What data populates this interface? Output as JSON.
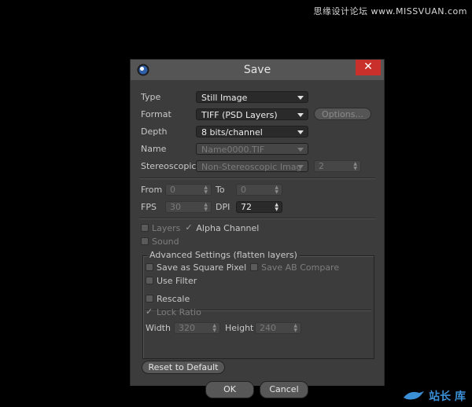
{
  "watermark_top": "思缘设计论坛 www.MISSVUAN.com",
  "watermark_bottom": "站长 库",
  "dialog": {
    "title": "Save",
    "close_glyph": "✕"
  },
  "fields": {
    "type": {
      "label": "Type",
      "value": "Still Image"
    },
    "format": {
      "label": "Format",
      "value": "TIFF (PSD Layers)"
    },
    "options_button": "Options...",
    "depth": {
      "label": "Depth",
      "value": "8 bits/channel"
    },
    "name": {
      "label": "Name",
      "value": "Name0000.TIF"
    },
    "stereoscopic": {
      "label": "Stereoscopic",
      "value": "Non-Stereoscopic Imag",
      "count": "2"
    },
    "from": {
      "label": "From",
      "value": "0"
    },
    "to": {
      "label": "To",
      "value": "0"
    },
    "fps": {
      "label": "FPS",
      "value": "30"
    },
    "dpi": {
      "label": "DPI",
      "value": "72"
    }
  },
  "checks": {
    "layers": "Layers",
    "alpha_channel": "Alpha Channel",
    "sound": "Sound"
  },
  "advanced": {
    "legend": "Advanced Settings (flatten layers)",
    "save_square_pixel": "Save as Square Pixel",
    "save_ab_compare": "Save AB Compare",
    "use_filter": "Use Filter",
    "rescale": "Rescale",
    "lock_ratio": "Lock Ratio",
    "width": {
      "label": "Width",
      "value": "320"
    },
    "height": {
      "label": "Height",
      "value": "240"
    }
  },
  "buttons": {
    "reset": "Reset to Default",
    "ok": "OK",
    "cancel": "Cancel"
  }
}
